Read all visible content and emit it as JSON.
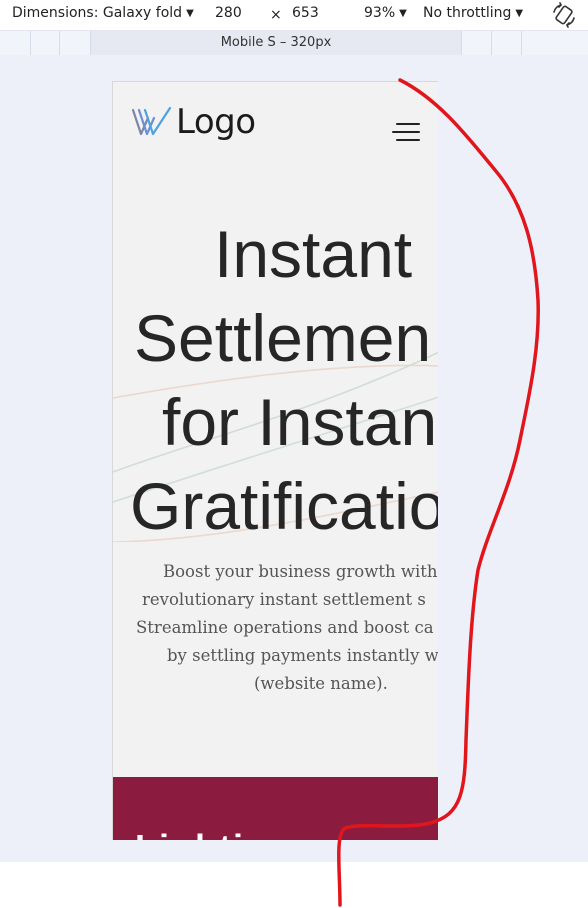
{
  "toolbar": {
    "dimensions_label": "Dimensions: Galaxy fold",
    "width_value": "280",
    "times_symbol": "×",
    "height_value": "653",
    "zoom": "93%",
    "throttling": "No throttling"
  },
  "media_query_bar": {
    "active_label": "Mobile S – 320px"
  },
  "site": {
    "logo_text": "Logo",
    "hero": {
      "title_lines": [
        "Instant",
        "Settlemen",
        "for Instan",
        "Gratificatio"
      ],
      "description_lines": [
        "Boost your business growth with",
        "revolutionary instant settlement s",
        "Streamline operations and boost ca",
        "by settling payments instantly w",
        "(website name)."
      ]
    },
    "next_section_partial": "Lighti"
  },
  "colors": {
    "workspace_bg": "#edf0f8",
    "device_bg": "#f2f2f2",
    "footer_band": "#8b1c3f",
    "annotation_stroke": "#e0161c"
  }
}
